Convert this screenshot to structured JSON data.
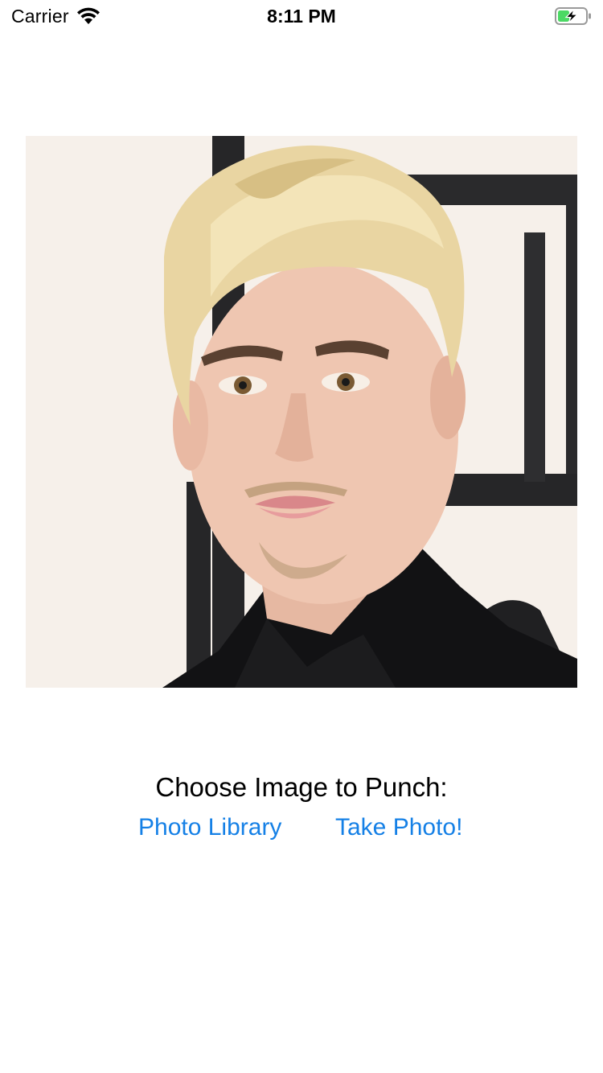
{
  "status_bar": {
    "carrier": "Carrier",
    "time": "8:11 PM",
    "battery_state": "charging",
    "battery_color": "#4cd964"
  },
  "photo": {
    "subject": "portrait photo of a young man with blonde hair in a black shirt"
  },
  "prompt": {
    "label": "Choose Image to Punch:"
  },
  "actions": {
    "photo_library_label": "Photo Library",
    "take_photo_label": "Take Photo!"
  },
  "colors": {
    "link": "#1580e6",
    "text": "#000000",
    "background": "#ffffff"
  }
}
